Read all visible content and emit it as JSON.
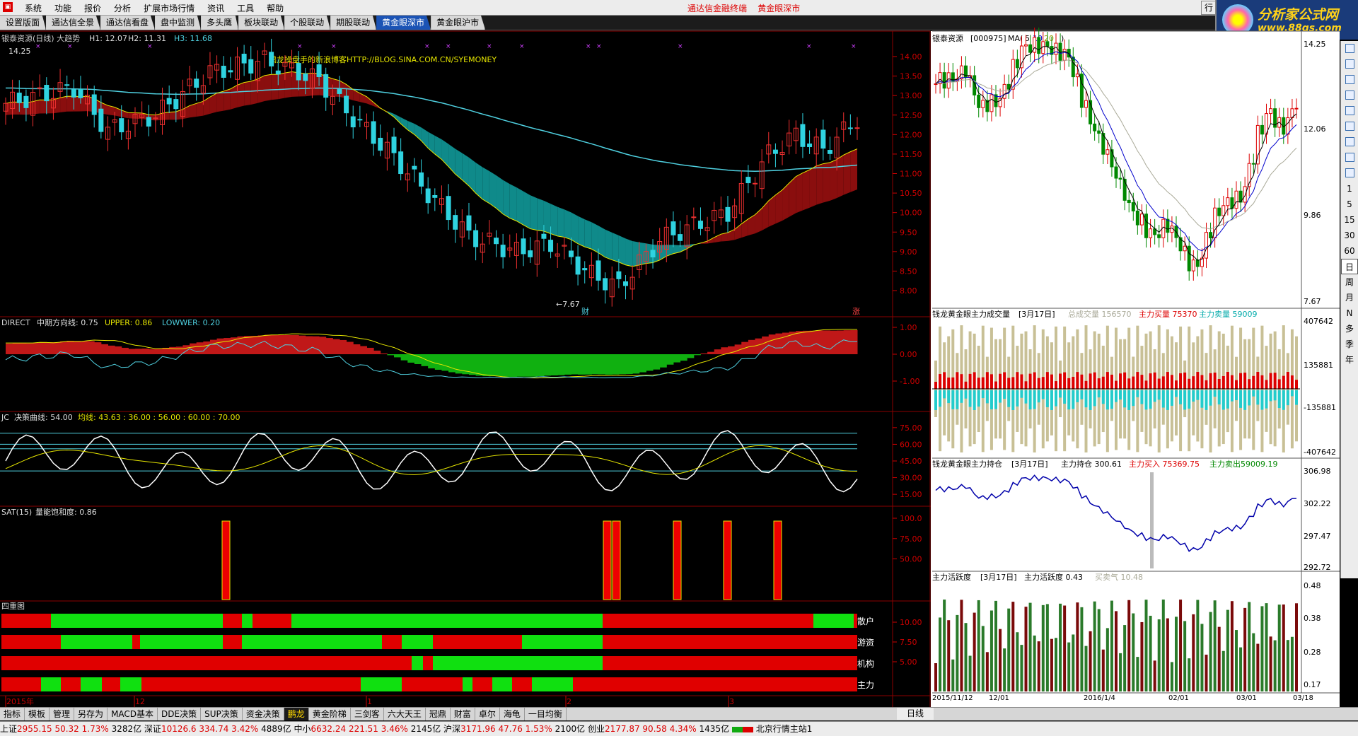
{
  "menu": {
    "items": [
      "系统",
      "功能",
      "报价",
      "分析",
      "扩展市场行情",
      "资讯",
      "工具",
      "帮助"
    ],
    "title_left": "通达信金融终端",
    "title_right": "黄金眼深市",
    "window_btn": "行"
  },
  "watermark": {
    "line1": "分析家公式网",
    "line2": "www.88gs.com"
  },
  "tabs": [
    "设置版面",
    "通达信全景",
    "通达信看盘",
    "盘中监测",
    "多头鹰",
    "板块联动",
    "个股联动",
    "期股联动",
    "黄金眼深市",
    "黄金眼沪市"
  ],
  "active_tab": 8,
  "main": {
    "title": "银泰资源(日线) 大趋势",
    "h1": "H1: 12.07",
    "h2": "H2: 11.31",
    "h3": "H3: 11.68",
    "blog": "鹏龙操盘手的新浪博客HTTP://BLOG.SINA.COM.CN/SYEMONEY",
    "hi_label": "14.25",
    "lo_label": "←7.67",
    "cai": "财",
    "zhang": "涨",
    "yticks": [
      "14.00",
      "13.50",
      "13.00",
      "12.50",
      "12.00",
      "11.50",
      "11.00",
      "10.50",
      "10.00",
      "9.50",
      "9.00",
      "8.50",
      "8.00"
    ]
  },
  "direct": {
    "name": "DIRECT",
    "label": "中期方向线: 0.75",
    "upper": "UPPER: 0.86",
    "lower": "LOWWER: 0.20",
    "yticks": [
      "1.00",
      "0.00",
      "-1.00"
    ]
  },
  "jc": {
    "name": "JC",
    "label": "决策曲线: 54.00",
    "ma": "均线: 43.63 : 36.00 : 56.00 : 60.00 : 70.00",
    "yticks": [
      "75.00",
      "60.00",
      "45.00",
      "30.00",
      "15.00"
    ]
  },
  "sat": {
    "name": "SAT(15)",
    "label": "量能饱和度: 0.86",
    "yticks": [
      "100.0",
      "75.00",
      "50.00"
    ]
  },
  "four": {
    "name": "四重图",
    "rows": [
      "散户",
      "游资",
      "机构",
      "主力"
    ],
    "yticks": [
      "10.00",
      "7.50",
      "5.00"
    ]
  },
  "xaxis": {
    "labels": [
      "2015年",
      "12",
      "1",
      "2",
      "3"
    ],
    "period": "日线"
  },
  "right": {
    "price": {
      "title": "银泰资源",
      "code": "[000975]",
      "ma": "MA(",
      "ma1": "5",
      "ma2": "10",
      "ma3": "20",
      "close": ")",
      "yticks": [
        "14.25",
        "12.06",
        "9.86",
        "7.67"
      ]
    },
    "vol": {
      "title": "钱龙黄金眼主力成交量",
      "date": "[3月17日]",
      "total": "总成交量 156570",
      "buy": "主力买量 75370",
      "sell": "主力卖量 59009",
      "yticks": [
        "407642",
        "135881",
        "-135881",
        "-407642"
      ]
    },
    "hold": {
      "title": "钱龙黄金眼主力持仓",
      "date": "[3月17日]",
      "val": "主力持仓 300.61",
      "buy": "主力买入 75369.75",
      "sell": "主力卖出59009.19",
      "yticks": [
        "306.98",
        "302.22",
        "297.47",
        "292.72"
      ]
    },
    "act": {
      "title": "主力活跃度",
      "date": "[3月17日]",
      "val": "主力活跃度 0.43",
      "mq": "买卖气 10.48",
      "yticks": [
        "0.48",
        "0.38",
        "0.28",
        "0.17"
      ]
    },
    "xlabels": [
      "2015/11/12",
      "12/01",
      "2016/1/4",
      "02/01",
      "03/01",
      "03/18"
    ]
  },
  "right_toolbar": [
    "1",
    "5",
    "15",
    "30",
    "60",
    "日",
    "周",
    "月",
    "N",
    "多",
    "季",
    "年"
  ],
  "bottom_tabs": [
    "指标",
    "模板",
    "管理",
    "另存为",
    "MACD基本",
    "DDE决策",
    "SUP决策",
    "资金决策",
    "鹏龙",
    "黄金阶梯",
    "三剑客",
    "六大天王",
    "冠鼎",
    "财富",
    "卓尔",
    "海龟",
    "一目均衡"
  ],
  "bottom_active": 8,
  "status": {
    "sh": {
      "name": "上证",
      "val": "2955.15",
      "chg": "50.32",
      "pct": "1.73%",
      "amt": "3282亿"
    },
    "sz": {
      "name": "深证",
      "val": "10126.6",
      "chg": "334.74",
      "pct": "3.42%",
      "amt": "4889亿"
    },
    "zx": {
      "name": "中小",
      "val": "6632.24",
      "chg": "221.51",
      "pct": "3.46%",
      "amt": "2145亿"
    },
    "hs": {
      "name": "沪深",
      "val": "3171.96",
      "chg": "47.76",
      "pct": "1.53%",
      "amt": "2100亿"
    },
    "cy": {
      "name": "创业",
      "val": "2177.87",
      "chg": "90.58",
      "pct": "4.34%",
      "amt": "1435亿"
    },
    "site": "北京行情主站1"
  },
  "colors": {
    "up": "#c0141b",
    "down": "#2fd3e0",
    "green": "#1ec61e",
    "yellow": "#e6e600",
    "cyan": "#4fd0e0"
  }
}
